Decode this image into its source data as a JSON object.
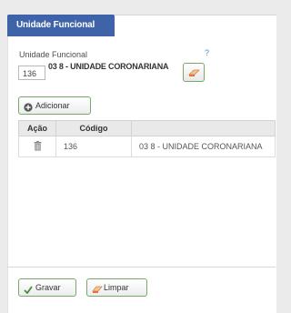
{
  "tab": {
    "title": "Unidade Funcional"
  },
  "form": {
    "field_label": "Unidade Funcional",
    "help_mark": "?",
    "code_value": "136",
    "unit_name": "03 8 - UNIDADE CORONARIANA"
  },
  "actions": {
    "add_label": "Adicionar"
  },
  "table": {
    "headers": {
      "acao": "Ação",
      "codigo": "Código",
      "descricao": ""
    },
    "rows": [
      {
        "codigo": "136",
        "descricao": "03 8 - UNIDADE CORONARIANA"
      }
    ]
  },
  "footer": {
    "save_label": "Gravar",
    "clear_label": "Limpar"
  },
  "colors": {
    "tab_blue": "#3e63a8",
    "button_border_green": "#78a86a",
    "help_blue": "#4f8bd0"
  },
  "icons": {
    "add": "plus-circle-icon",
    "delete": "trash-icon",
    "clear": "eraser-icon",
    "save": "checkmark-icon"
  }
}
